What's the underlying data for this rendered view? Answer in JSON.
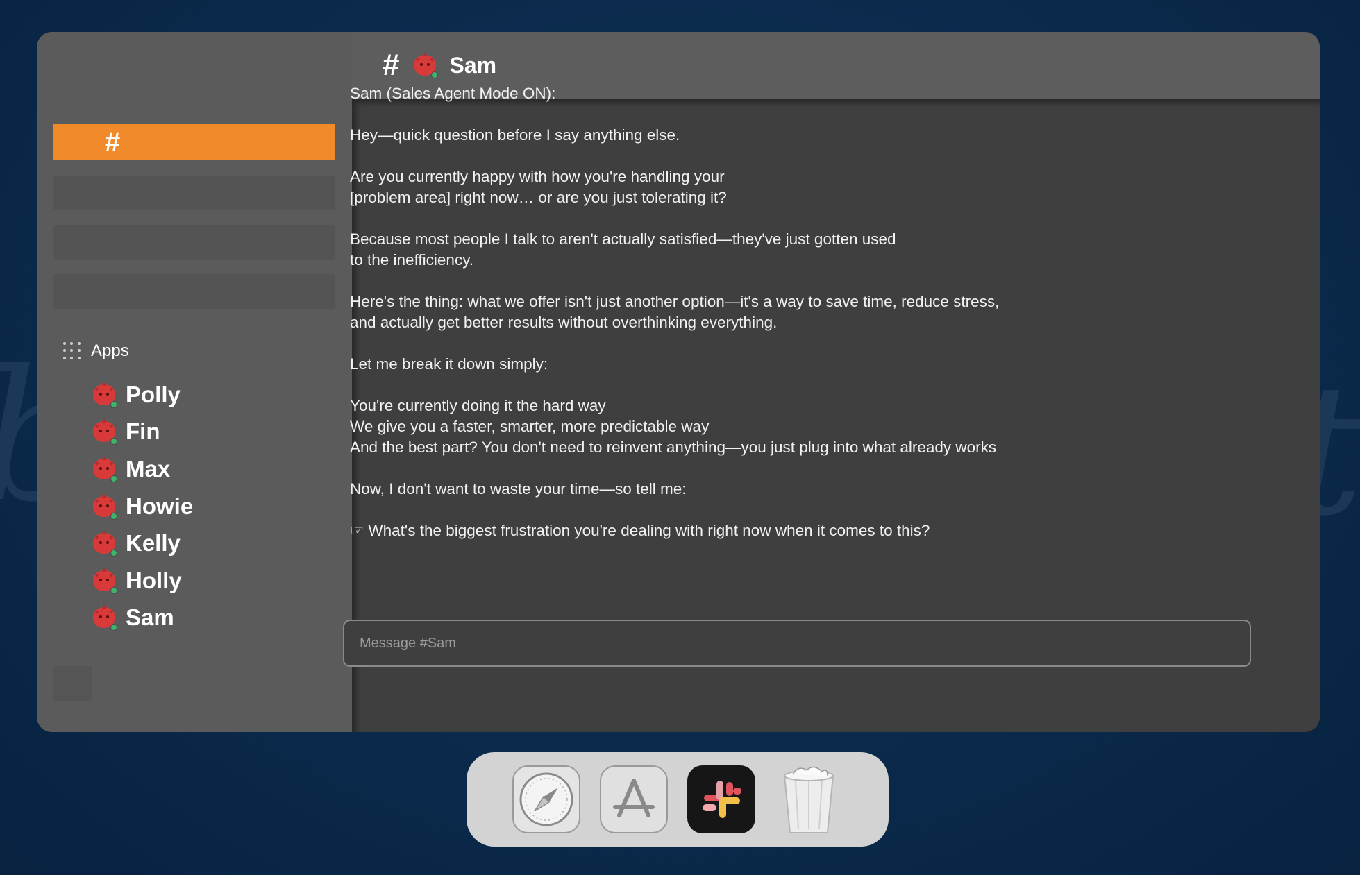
{
  "background": {
    "left_script": "b",
    "right_script": "t"
  },
  "channel": {
    "hash": "#",
    "name": "Sam"
  },
  "sidebar": {
    "active_channel_label": "#",
    "apps_label": "Apps",
    "apps": [
      {
        "label": "Polly"
      },
      {
        "label": "Fin"
      },
      {
        "label": "Max"
      },
      {
        "label": "Howie"
      },
      {
        "label": "Kelly"
      },
      {
        "label": "Holly"
      },
      {
        "label": "Sam"
      }
    ]
  },
  "messages": [
    "Sam (Sales Agent Mode ON):",
    "Hey—quick question before I say anything else.",
    "Are you currently happy with how you're handling your\n[problem area] right now… or are you just tolerating it?",
    "Because most people I talk to aren't actually satisfied—they've just gotten used\nto the inefficiency.",
    "Here's the thing: what we offer isn't just another option—it's a way to save time, reduce stress,\nand actually get better results without overthinking everything.",
    "Let me break it down simply:",
    "You're currently doing it the hard way\nWe give you a faster, smarter, more predictable way\nAnd the best part? You don't need to reinvent anything—you just plug into what already works",
    "Now, I don't want to waste your time—so tell me:",
    "☞ What's the biggest frustration you're dealing with right now when it comes to this?"
  ],
  "composer": {
    "placeholder": "Message #Sam"
  },
  "colors": {
    "accent": "#f08a2b",
    "avatar": "#d83a3a",
    "online": "#3fb36b"
  },
  "dock": [
    {
      "icon": "safari-icon"
    },
    {
      "icon": "app-store-icon"
    },
    {
      "icon": "slack-icon"
    },
    {
      "icon": "trash-icon"
    }
  ]
}
